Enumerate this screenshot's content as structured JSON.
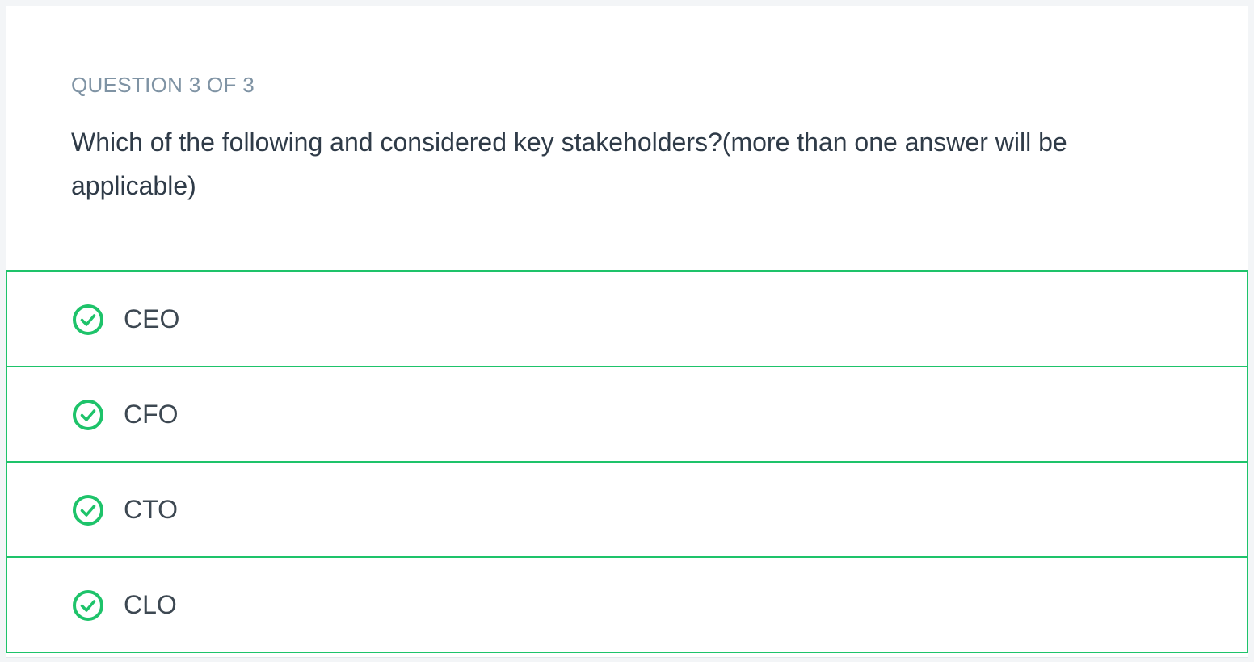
{
  "quiz": {
    "counter": "QUESTION 3 OF 3",
    "question": "Which of the following and considered key stakeholders?(more than one answer will be applicable)",
    "accent_color": "#1ec36a",
    "answers": [
      {
        "label": "CEO",
        "icon": "check-circle-icon",
        "selected": true
      },
      {
        "label": "CFO",
        "icon": "check-circle-icon",
        "selected": true
      },
      {
        "label": "CTO",
        "icon": "check-circle-icon",
        "selected": true
      },
      {
        "label": "CLO",
        "icon": "check-circle-icon",
        "selected": true
      }
    ]
  }
}
